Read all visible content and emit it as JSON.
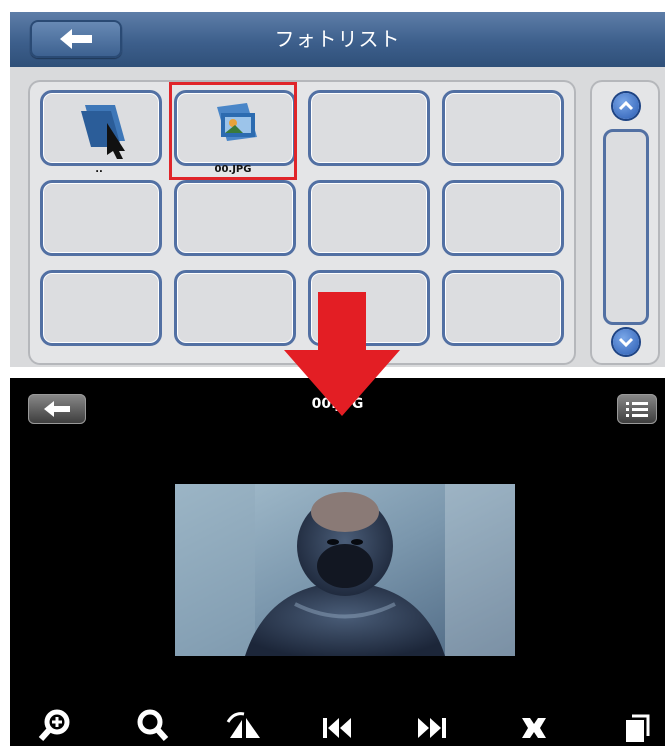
{
  "top_screen": {
    "title": "フォトリスト",
    "grid": [
      {
        "label": ".."
      },
      {
        "label": "00.JPG"
      },
      {
        "label": ""
      },
      {
        "label": ""
      },
      {
        "label": ""
      },
      {
        "label": ""
      },
      {
        "label": ""
      },
      {
        "label": ""
      },
      {
        "label": ""
      },
      {
        "label": ""
      },
      {
        "label": ""
      },
      {
        "label": ""
      }
    ],
    "selected_index": 1
  },
  "bottom_screen": {
    "title": "00.JPG",
    "toolbar": [
      {
        "icon": "zoom-in-icon"
      },
      {
        "icon": "zoom-out-icon"
      },
      {
        "icon": "rotate-icon"
      },
      {
        "icon": "previous-icon"
      },
      {
        "icon": "next-icon"
      },
      {
        "icon": "fit-screen-icon"
      },
      {
        "icon": "copy-icon"
      }
    ]
  },
  "colors": {
    "header_blue": "#3d5f8c",
    "cell_border": "#5270a3",
    "selection": "#e0252a",
    "arrow": "#e31e24"
  }
}
